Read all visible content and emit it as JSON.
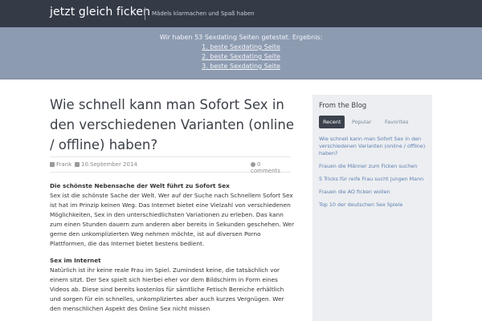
{
  "header": {
    "site_title": "jetzt gleich ficken",
    "tagline": "Mädels klarmachen und Spaß haben"
  },
  "promo": {
    "intro": "Wir haben 53 Sexdating Seiten getestet. Ergebnis:",
    "links": [
      "1. beste Sexdating Seite",
      "2. beste Sexdating Seite",
      "3. beste Sexdating Seite"
    ]
  },
  "post": {
    "title": "Wie schnell kann man Sofort Sex in den verschiedenen Varianten (online / offline) haben?",
    "author": "Frank",
    "date": "10.September 2014",
    "comments": "0 comments",
    "sections": [
      {
        "heading": "Die schönste Nebensache der Welt führt zu Sofort Sex",
        "text": "Sex ist die schönste Sache der Welt. Wer auf der Suche nach Schnellem Sofort Sex ist hat im Prinzip keinen Weg. Das Internet bietet eine Vielzahl von verschiedenen Möglichkeiten, Sex in den unterschiedlichsten Variationen zu erleben. Das kann zum einen Stunden dauern zum anderen aber bereits in Sekunden geschehen. Wer gerne den unkomplizierten Weg nehmen möchte, ist auf diversen Porno Plattformen, die das Internet bietet bestens bedient."
      },
      {
        "heading": "Sex im Internet",
        "text": "Natürlich ist ihr keine reale Frau im Spiel. Zumindest keine, die tatsächlich vor einem sitzt. Der Sex spielt sich hierbei eher vor dem Bildschirm in Form eines Videos ab. Diese sind bereits kostenlos für sämtliche Fetisch Bereiche erhältlich und sorgen für ein schnelles, unkompliziertes aber auch kurzes Vergnügen. Wer den menschlichen Aspekt des Online Sex nicht missen"
      }
    ]
  },
  "sidebar": {
    "title": "From the Blog",
    "tabs": [
      "Recent",
      "Popular",
      "Favorites"
    ],
    "items": [
      "Wie schnell kann man Sofort Sex in den verschiedenen Varianten (online / offline) haben?",
      "Frauen die Männer zum Ficken suchen",
      "5 Tricks für reife Frau sucht jungen Mann",
      "Frauen die AO ficken wollen",
      "Top 10 der deutschen Sex Spiele"
    ]
  }
}
